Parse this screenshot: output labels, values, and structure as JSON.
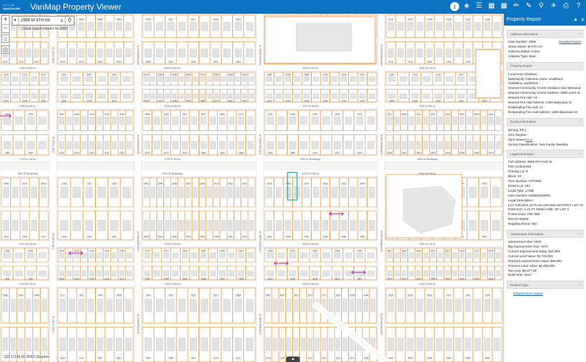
{
  "header": {
    "logo_line1": "CITY OF",
    "logo_line2": "VANCOUVER",
    "title": "VanMap Property Viewer",
    "tools": [
      "info-icon",
      "layers-icon",
      "list-icon",
      "basemap-icon",
      "print-icon",
      "measure-icon",
      "draw-icon",
      "search-map-icon",
      "lightbulb-icon",
      "printer-icon",
      "help-icon"
    ]
  },
  "search": {
    "value": "2958 W 8TH AV",
    "hint": "Show search results for 2958"
  },
  "map": {
    "colors": {
      "parcel": "#f08a2a",
      "selected": "#2bb5a6",
      "street": "#ffffff",
      "arrow": "#b61ab0"
    },
    "streets_h": [
      "2900 W 6th Av",
      "3000 W 6th Av",
      "2900 W 7th Av",
      "3200 W 7th Av",
      "2900 W 8th Av",
      "3000 W 8th Av",
      "3100 W 8th Av",
      "3200 W 8th Av",
      "2700 W 7th Av",
      "2700 W 8th Av",
      "3000 W Broadway",
      "2900 W Broadway",
      "3200 W Broadway",
      "2700 W Broadway",
      "3100 W 10th Av",
      "2900 W 10th Av",
      "2700 W 10th Av"
    ],
    "streets_v": [
      "2100 Trutch St",
      "2100 Balaclava St",
      "2100 Bayswater St",
      "2100 Macdonald St",
      "2200 Stephens St"
    ],
    "parcel_numbers": [
      "2206",
      "2208",
      "2210",
      "2212",
      "2216",
      "2220",
      "2226",
      "2231",
      "2237",
      "2241",
      "2245",
      "2251",
      "2999",
      "2979",
      "2969",
      "2959",
      "2945",
      "2937",
      "2929",
      "2915",
      "2906",
      "2914",
      "2918",
      "2922",
      "2926",
      "2930",
      "2936",
      "2940",
      "2948",
      "2950",
      "2960",
      "2965",
      "2975",
      "2983",
      "2988",
      "2990",
      "3003",
      "3015",
      "3025",
      "3033",
      "3047",
      "3057",
      "3061",
      "3091",
      "3176",
      "3170",
      "3162",
      "3158",
      "3144",
      "3140",
      "3136",
      "3128",
      "3120",
      "3116",
      "3110",
      "2301",
      "2305",
      "2311",
      "2315",
      "2318",
      "2325",
      "2331",
      "2336",
      "2341",
      "2345",
      "2351",
      "2355",
      "3150",
      "3153",
      "3140",
      "3133",
      "3125",
      "3117",
      "3111",
      "2444",
      "2428",
      "2415",
      "2411",
      "2402",
      "2501",
      "2505",
      "2511",
      "2517",
      "2525",
      "2531",
      "2535",
      "2541",
      "2545",
      "2551",
      "2563",
      "2920",
      "2944",
      "2958",
      "2966",
      "2976",
      "2980",
      "2988",
      "2992",
      "2994",
      "2912",
      "2908",
      "2904",
      "2895",
      "2875",
      "2861",
      "2857",
      "2849",
      "2839",
      "2827",
      "2817",
      "2803",
      "2731",
      "2679",
      "2674",
      "2670",
      "2664",
      "2660",
      "2656",
      "2652",
      "2646",
      "2638",
      "2632",
      "2626",
      "2618",
      "2612",
      "2610",
      "2606",
      "2602",
      "2598",
      "2594",
      "2590",
      "2586",
      "2582",
      "2578",
      "2574",
      "2570",
      "2566",
      "2562",
      "2558",
      "2554",
      "2550",
      "2546",
      "2542",
      "2538",
      "2534",
      "2528",
      "2524",
      "2520",
      "2516",
      "2512",
      "2508",
      "2504",
      "2500",
      "3204",
      "3208",
      "3212",
      "3216",
      "3220",
      "3224",
      "3228",
      "3232",
      "3236",
      "3240",
      "3244",
      "3248",
      "3252",
      "3256",
      "3260",
      "3264",
      "3268",
      "3272",
      "3276",
      "3280",
      "3284",
      "3288"
    ],
    "coords_readout": "-123.17146 49.26437 Degrees"
  },
  "panel": {
    "title": "Property Report",
    "sections": [
      {
        "title": "Address Information",
        "rows": [
          {
            "text": "Civic Number: 2958",
            "link": "Detailed Report"
          },
          {
            "text": "Street Name: W 8TH AV"
          },
          {
            "text": "Address Status: Active"
          },
          {
            "text": "Address Type: Main"
          }
        ]
      },
      {
        "title": "Property Report",
        "rows": [
          {
            "text": "Local Area: Kitsilano"
          },
          {
            "text": "Multi-family Collection Zone: undefined"
          },
          {
            "text": "Sanitation: undefined"
          },
          {
            "text": "Nearest Community Centre: Kitsilano War Memorial"
          },
          {
            "text": "Nearest Community Centre Address: 2690 Larch St"
          },
          {
            "text": "Nearest Fire Hall: 12"
          },
          {
            "text": "Nearest Fire Hall Address: 2460 Balaclava St"
          },
          {
            "text": "Responding Fire Hall: 12"
          },
          {
            "text": "Responding Fire Hall Address: 2460 Balaclava St"
          }
        ]
      },
      {
        "title": "Zoning Information",
        "rows": [
          {
            "text": "Zoning: R1-1"
          },
          {
            "text": "CD1 Number:"
          },
          {
            "text": "Zone Name: ",
            "inline_link": "R1-1"
          },
          {
            "text": "Zoning Classification: Two-Family Dwelling"
          }
        ]
      },
      {
        "title": "Legal Information",
        "rows": [
          {
            "text": "Full Address: 2958 8TH AVE W"
          },
          {
            "text": "PID: 014543460"
          },
          {
            "text": "Primary Lot: 9"
          },
          {
            "text": "Block: 32"
          },
          {
            "text": "Plan Number: VAP1582"
          },
          {
            "text": "District Lot: 192"
          },
          {
            "text": "Legal Type: LAND"
          },
          {
            "text": "Folio Number: 648062320000"
          },
          {
            "text": "Legal Description:"
          },
          {
            "text": "LOT 9 BLOCK 32 PLAN VAP1582 DISTRICT LOT 192"
          },
          {
            "text": "NWD EXC S 15 FT NOW LANE, OF LOT 3."
          },
          {
            "text": "Postal Code: V6K 2B9"
          },
          {
            "text": "Record Status:"
          },
          {
            "text": "Neighbourhood: 002"
          }
        ]
      },
      {
        "title": "Assessment Information",
        "rows": [
          {
            "text": "Assessment Year: 2022"
          },
          {
            "text": "Big Improvement Year: 1971"
          },
          {
            "text": "Current Improvement Value: $37,900"
          },
          {
            "text": "Current Land Value: $2,742,000"
          },
          {
            "text": "Previous Improvement Value: $36,000"
          },
          {
            "text": "Previous Land Value: $2,485,000"
          },
          {
            "text": "Tax Levy: $9,377.08"
          },
          {
            "text": "Build Year: 1912"
          }
        ]
      },
      {
        "title": "Related Apps",
        "links": [
          "Infrastructure Viewer"
        ]
      }
    ]
  }
}
